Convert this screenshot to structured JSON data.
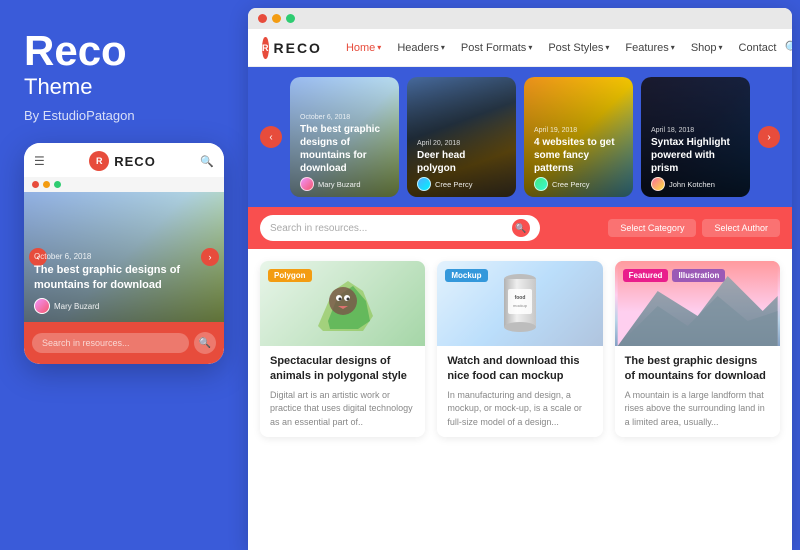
{
  "brand": {
    "title": "Reco",
    "subtitle": "Theme",
    "by": "By EstudioPatagon"
  },
  "browser_dots": [
    {
      "color": "#e74c3c"
    },
    {
      "color": "#f39c12"
    },
    {
      "color": "#2ecc71"
    }
  ],
  "mobile_dots": [
    {
      "color": "#e74c3c"
    },
    {
      "color": "#f39c12"
    },
    {
      "color": "#2ecc71"
    }
  ],
  "nav": {
    "logo_letter": "R",
    "logo_text": "RECO",
    "items": [
      {
        "label": "Home",
        "active": true,
        "has_dropdown": true
      },
      {
        "label": "Headers",
        "has_dropdown": true
      },
      {
        "label": "Post Formats",
        "has_dropdown": true
      },
      {
        "label": "Post Styles",
        "has_dropdown": true
      },
      {
        "label": "Features",
        "has_dropdown": true
      },
      {
        "label": "Shop",
        "has_dropdown": true
      },
      {
        "label": "Contact"
      }
    ]
  },
  "hero_cards": [
    {
      "date": "October 6, 2018",
      "title": "The best graphic designs of mountains for download",
      "author": "Mary Buzard",
      "bg_class": "card-bg-1"
    },
    {
      "date": "April 20, 2018",
      "title": "Deer head polygon",
      "author": "Cree Percy",
      "bg_class": "card-deer"
    },
    {
      "date": "April 19, 2018",
      "title": "4 websites to get some fancy patterns",
      "author": "Cree Percy",
      "bg_class": "card-bg-3"
    },
    {
      "date": "April 18, 2018",
      "title": "Syntax Highlight powered with prism",
      "author": "John Kotchen",
      "bg_class": "card-bg-4"
    }
  ],
  "search": {
    "placeholder": "Search in resources...",
    "category_placeholder": "Select Category",
    "author_placeholder": "Select Author"
  },
  "articles": [
    {
      "badge": "Polygon",
      "badge_class": "badge-yellow",
      "title": "Spectacular designs of animals in polygonal style",
      "excerpt": "Digital art is an artistic work or practice that uses digital technology as an essential part of.."
    },
    {
      "badge": "Mockup",
      "badge_class": "badge-blue",
      "title": "Watch and download this nice food can mockup",
      "excerpt": "In manufacturing and design, a mockup, or mock-up, is a scale or full-size model of a design..."
    },
    {
      "badge2": "Featured",
      "badge2_class": "badge-pink",
      "badge3": "Illustration",
      "badge3_class": "badge-purple",
      "title": "The best graphic designs of mountains for download",
      "excerpt": "A mountain is a large landform that rises above the surrounding land in a limited area, usually..."
    }
  ],
  "mobile": {
    "logo_letter": "R",
    "logo_text": "RECO",
    "hero_date": "October 6, 2018",
    "hero_title": "The best graphic designs of mountains for download",
    "hero_author": "Mary Buzard",
    "search_placeholder": "Search in resources..."
  }
}
